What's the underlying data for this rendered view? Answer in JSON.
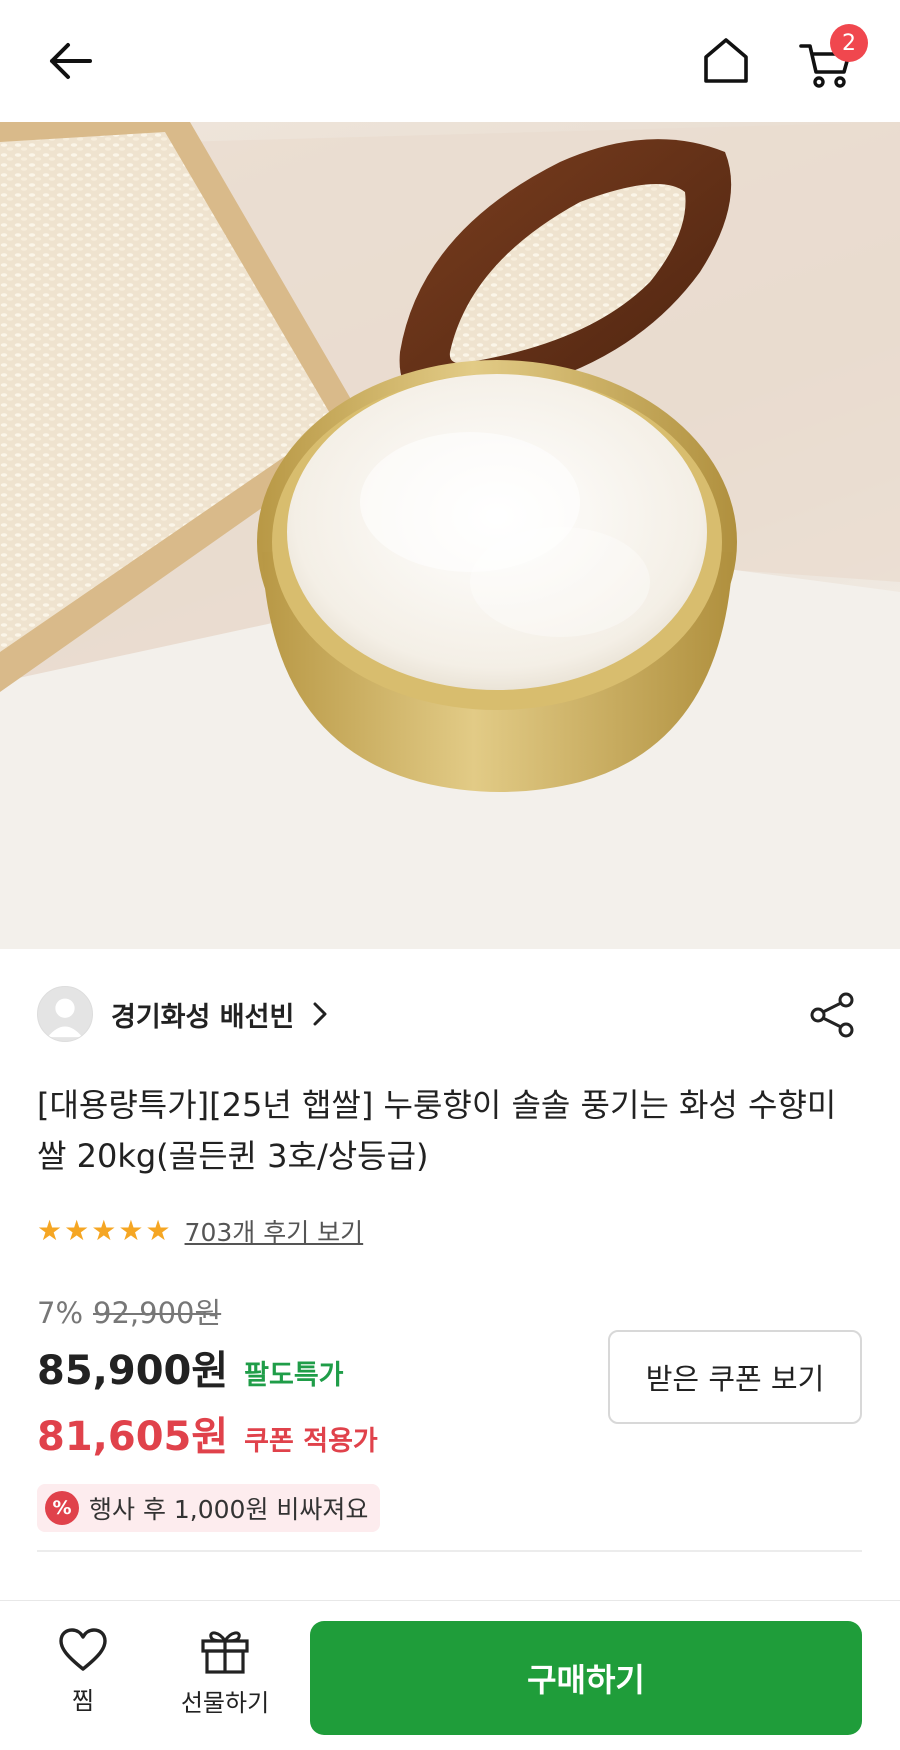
{
  "header": {
    "back_icon": "arrow-left-icon",
    "home_icon": "home-icon",
    "cart_icon": "cart-icon",
    "cart_count": "2"
  },
  "hero": {
    "slide_count": 1,
    "current_slide": 1
  },
  "seller": {
    "name": "경기화성 배선빈"
  },
  "product": {
    "title": "[대용량특가][25년 햅쌀] 누룽향이 솔솔 풍기는 화성 수향미 쌀 20kg(골든퀸 3호/상등급)",
    "rating_stars": 5,
    "review_link": "703개 후기 보기"
  },
  "price": {
    "discount": "7%",
    "original": "92,900원",
    "sale": "85,900원",
    "sale_label": "팔도특가",
    "coupon_price": "81,605원",
    "coupon_label": "쿠폰 적용가",
    "coupon_button": "받은 쿠폰 보기"
  },
  "notice": {
    "text": "행사 후 1,000원 비싸져요",
    "icon": "percent-icon"
  },
  "bottom": {
    "wish_label": "찜",
    "gift_label": "선물하기",
    "buy_label": "구매하기"
  },
  "colors": {
    "accent_green": "#1f9d3a",
    "price_red": "#e0424b",
    "badge_red": "#f0474e",
    "star": "#f5a623"
  }
}
